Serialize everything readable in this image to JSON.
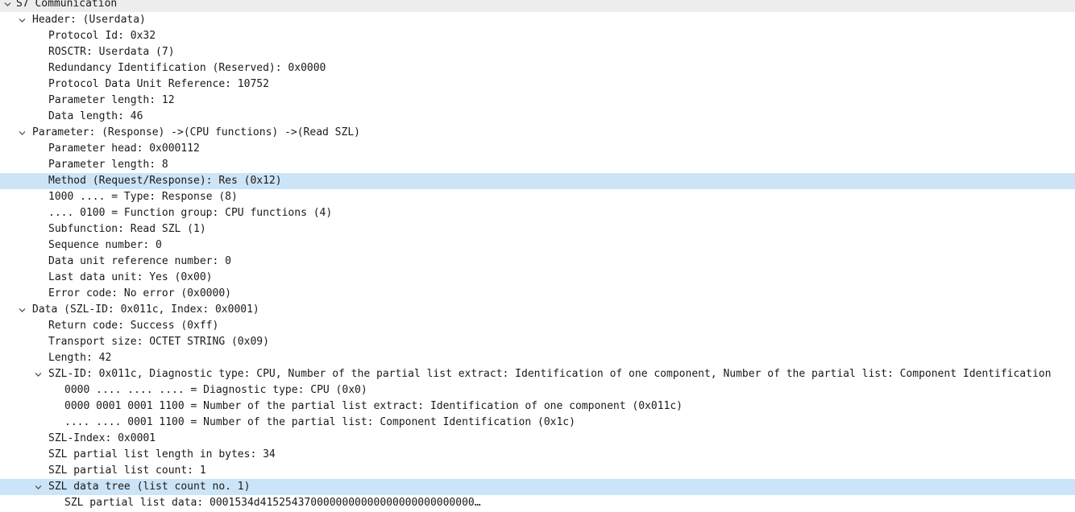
{
  "tree": {
    "root": "S7 Communication",
    "header": {
      "label": "Header: (Userdata)",
      "items": [
        "Protocol Id: 0x32",
        "ROSCTR: Userdata (7)",
        "Redundancy Identification (Reserved): 0x0000",
        "Protocol Data Unit Reference: 10752",
        "Parameter length: 12",
        "Data length: 46"
      ]
    },
    "parameter": {
      "label": "Parameter: (Response) ->(CPU functions) ->(Read SZL)",
      "items": [
        "Parameter head: 0x000112",
        "Parameter length: 8",
        "Method (Request/Response): Res (0x12)",
        "1000 .... = Type: Response (8)",
        ".... 0100 = Function group: CPU functions (4)",
        "Subfunction: Read SZL (1)",
        "Sequence number: 0",
        "Data unit reference number: 0",
        "Last data unit: Yes (0x00)",
        "Error code: No error (0x0000)"
      ]
    },
    "data": {
      "label": "Data (SZL-ID: 0x011c, Index: 0x0001)",
      "items": [
        "Return code: Success (0xff)",
        "Transport size: OCTET STRING (0x09)",
        "Length: 42"
      ],
      "szl_id": {
        "label": "SZL-ID: 0x011c, Diagnostic type: CPU, Number of the partial list extract: Identification of one component, Number of the partial list: Component Identification",
        "items": [
          "0000 .... .... .... = Diagnostic type: CPU (0x0)",
          "0000 0001 0001 1100 = Number of the partial list extract: Identification of one component (0x011c)",
          ".... .... 0001 1100 = Number of the partial list: Component Identification (0x1c)"
        ]
      },
      "items_after": [
        "SZL-Index: 0x0001",
        "SZL partial list length in bytes: 34",
        "SZL partial list count: 1"
      ],
      "szl_data_tree": {
        "label": "SZL data tree (list count no. 1)",
        "items": [
          "SZL partial list data: 0001534d4152543700000000000000000000000000…"
        ]
      }
    }
  }
}
